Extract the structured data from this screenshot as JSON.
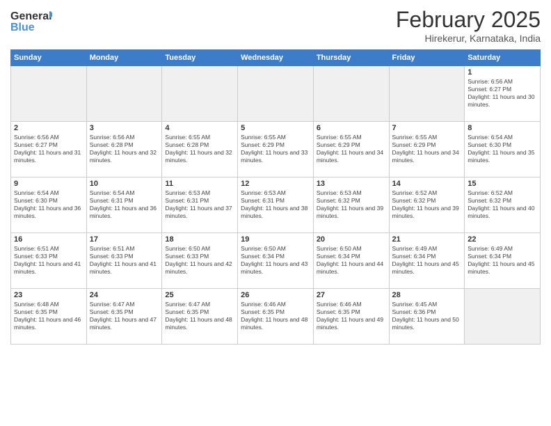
{
  "header": {
    "logo_line1": "General",
    "logo_line2": "Blue",
    "month_title": "February 2025",
    "location": "Hirekerur, Karnataka, India"
  },
  "days_of_week": [
    "Sunday",
    "Monday",
    "Tuesday",
    "Wednesday",
    "Thursday",
    "Friday",
    "Saturday"
  ],
  "weeks": [
    [
      {
        "day": "",
        "text": ""
      },
      {
        "day": "",
        "text": ""
      },
      {
        "day": "",
        "text": ""
      },
      {
        "day": "",
        "text": ""
      },
      {
        "day": "",
        "text": ""
      },
      {
        "day": "",
        "text": ""
      },
      {
        "day": "1",
        "text": "Sunrise: 6:56 AM\nSunset: 6:27 PM\nDaylight: 11 hours and 30 minutes."
      }
    ],
    [
      {
        "day": "2",
        "text": "Sunrise: 6:56 AM\nSunset: 6:27 PM\nDaylight: 11 hours and 31 minutes."
      },
      {
        "day": "3",
        "text": "Sunrise: 6:56 AM\nSunset: 6:28 PM\nDaylight: 11 hours and 32 minutes."
      },
      {
        "day": "4",
        "text": "Sunrise: 6:55 AM\nSunset: 6:28 PM\nDaylight: 11 hours and 32 minutes."
      },
      {
        "day": "5",
        "text": "Sunrise: 6:55 AM\nSunset: 6:29 PM\nDaylight: 11 hours and 33 minutes."
      },
      {
        "day": "6",
        "text": "Sunrise: 6:55 AM\nSunset: 6:29 PM\nDaylight: 11 hours and 34 minutes."
      },
      {
        "day": "7",
        "text": "Sunrise: 6:55 AM\nSunset: 6:29 PM\nDaylight: 11 hours and 34 minutes."
      },
      {
        "day": "8",
        "text": "Sunrise: 6:54 AM\nSunset: 6:30 PM\nDaylight: 11 hours and 35 minutes."
      }
    ],
    [
      {
        "day": "9",
        "text": "Sunrise: 6:54 AM\nSunset: 6:30 PM\nDaylight: 11 hours and 36 minutes."
      },
      {
        "day": "10",
        "text": "Sunrise: 6:54 AM\nSunset: 6:31 PM\nDaylight: 11 hours and 36 minutes."
      },
      {
        "day": "11",
        "text": "Sunrise: 6:53 AM\nSunset: 6:31 PM\nDaylight: 11 hours and 37 minutes."
      },
      {
        "day": "12",
        "text": "Sunrise: 6:53 AM\nSunset: 6:31 PM\nDaylight: 11 hours and 38 minutes."
      },
      {
        "day": "13",
        "text": "Sunrise: 6:53 AM\nSunset: 6:32 PM\nDaylight: 11 hours and 39 minutes."
      },
      {
        "day": "14",
        "text": "Sunrise: 6:52 AM\nSunset: 6:32 PM\nDaylight: 11 hours and 39 minutes."
      },
      {
        "day": "15",
        "text": "Sunrise: 6:52 AM\nSunset: 6:32 PM\nDaylight: 11 hours and 40 minutes."
      }
    ],
    [
      {
        "day": "16",
        "text": "Sunrise: 6:51 AM\nSunset: 6:33 PM\nDaylight: 11 hours and 41 minutes."
      },
      {
        "day": "17",
        "text": "Sunrise: 6:51 AM\nSunset: 6:33 PM\nDaylight: 11 hours and 41 minutes."
      },
      {
        "day": "18",
        "text": "Sunrise: 6:50 AM\nSunset: 6:33 PM\nDaylight: 11 hours and 42 minutes."
      },
      {
        "day": "19",
        "text": "Sunrise: 6:50 AM\nSunset: 6:34 PM\nDaylight: 11 hours and 43 minutes."
      },
      {
        "day": "20",
        "text": "Sunrise: 6:50 AM\nSunset: 6:34 PM\nDaylight: 11 hours and 44 minutes."
      },
      {
        "day": "21",
        "text": "Sunrise: 6:49 AM\nSunset: 6:34 PM\nDaylight: 11 hours and 45 minutes."
      },
      {
        "day": "22",
        "text": "Sunrise: 6:49 AM\nSunset: 6:34 PM\nDaylight: 11 hours and 45 minutes."
      }
    ],
    [
      {
        "day": "23",
        "text": "Sunrise: 6:48 AM\nSunset: 6:35 PM\nDaylight: 11 hours and 46 minutes."
      },
      {
        "day": "24",
        "text": "Sunrise: 6:47 AM\nSunset: 6:35 PM\nDaylight: 11 hours and 47 minutes."
      },
      {
        "day": "25",
        "text": "Sunrise: 6:47 AM\nSunset: 6:35 PM\nDaylight: 11 hours and 48 minutes."
      },
      {
        "day": "26",
        "text": "Sunrise: 6:46 AM\nSunset: 6:35 PM\nDaylight: 11 hours and 48 minutes."
      },
      {
        "day": "27",
        "text": "Sunrise: 6:46 AM\nSunset: 6:35 PM\nDaylight: 11 hours and 49 minutes."
      },
      {
        "day": "28",
        "text": "Sunrise: 6:45 AM\nSunset: 6:36 PM\nDaylight: 11 hours and 50 minutes."
      },
      {
        "day": "",
        "text": ""
      }
    ]
  ]
}
